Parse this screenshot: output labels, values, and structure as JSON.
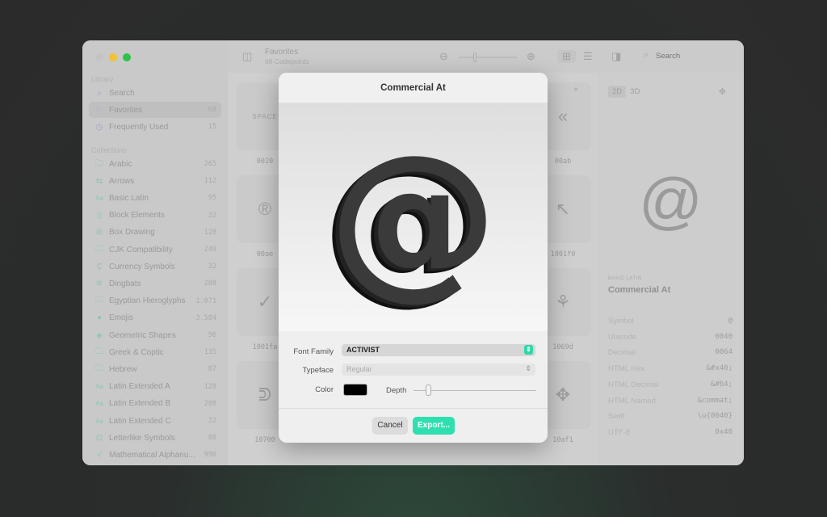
{
  "sidebar": {
    "library_label": "Library",
    "collections_label": "Collections",
    "library": [
      {
        "label": "Search",
        "icon": "search-icon"
      },
      {
        "label": "Favorites",
        "count": "68",
        "icon": "heart-icon"
      },
      {
        "label": "Frequently Used",
        "count": "15",
        "icon": "history-icon"
      }
    ],
    "collections": [
      {
        "label": "Arabic",
        "count": "265",
        "icon": "folder"
      },
      {
        "label": "Arrows",
        "count": "112",
        "icon": "arrows"
      },
      {
        "label": "Basic Latin",
        "count": "95",
        "icon": "Aa"
      },
      {
        "label": "Block Elements",
        "count": "32",
        "icon": "block"
      },
      {
        "label": "Box Drawing",
        "count": "128",
        "icon": "box"
      },
      {
        "label": "CJK Compatibility",
        "count": "249",
        "icon": "folder"
      },
      {
        "label": "Currency Symbols",
        "count": "32",
        "icon": "currency"
      },
      {
        "label": "Dingbats",
        "count": "208",
        "icon": "gear"
      },
      {
        "label": "Egyptian Hieroglyphs",
        "count": "1.071",
        "icon": "folder"
      },
      {
        "label": "Emojis",
        "count": "3.584",
        "icon": "smiley"
      },
      {
        "label": "Geometric Shapes",
        "count": "96",
        "icon": "shapes"
      },
      {
        "label": "Greek & Coptic",
        "count": "135",
        "icon": "folder"
      },
      {
        "label": "Hebrew",
        "count": "87",
        "icon": "folder"
      },
      {
        "label": "Latin Extended A",
        "count": "128",
        "icon": "Aa"
      },
      {
        "label": "Latin Extended B",
        "count": "208",
        "icon": "Aa"
      },
      {
        "label": "Latin Extended C",
        "count": "32",
        "icon": "Aa"
      },
      {
        "label": "Letterlike Symbols",
        "count": "80",
        "icon": "letter"
      },
      {
        "label": "Mathematical Alphanu...",
        "count": "996",
        "icon": "sqrt"
      }
    ]
  },
  "toolbar": {
    "title": "Favorites",
    "subtitle": "68 Codepoints",
    "search_placeholder": "Search"
  },
  "grid": {
    "left": [
      {
        "glyph": "SPACE",
        "code": "0020"
      },
      {
        "glyph": "®",
        "code": "00ae"
      },
      {
        "glyph": "✓",
        "code": "1001fa"
      },
      {
        "glyph": "ᕲ",
        "code": "10700"
      }
    ],
    "right": [
      {
        "glyph": "«",
        "code": "00ab"
      },
      {
        "glyph": "↖",
        "code": "1001f0"
      },
      {
        "glyph": "⚘",
        "code": "1069d"
      },
      {
        "glyph": "✥",
        "code": "10af1"
      }
    ]
  },
  "inspector": {
    "mode_2d": "2D",
    "mode_3d": "3D",
    "glyph": "@",
    "category": "BASIC LATIN",
    "name": "Commercial At",
    "rows": [
      {
        "k": "Symbol",
        "v": "@"
      },
      {
        "k": "Unicode",
        "v": "0040"
      },
      {
        "k": "Decimal",
        "v": "0064"
      },
      {
        "k": "HTML Hex",
        "v": "&#x40;"
      },
      {
        "k": "HTML Decimal",
        "v": "&#64;"
      },
      {
        "k": "HTML Named",
        "v": "&commat;"
      },
      {
        "k": "Swift",
        "v": "\\u{0040}"
      },
      {
        "k": "UTF-8",
        "v": "0x40"
      }
    ]
  },
  "dialog": {
    "title": "Commercial At",
    "glyph": "@",
    "font_family_label": "Font Family",
    "font_family": "ACTIVIST",
    "typeface_label": "Typeface",
    "typeface": "Regular",
    "color_label": "Color",
    "color": "#000000",
    "depth_label": "Depth",
    "depth": 0.1,
    "cancel": "Cancel",
    "export": "Export...",
    "accent": "#2ee0b0"
  }
}
